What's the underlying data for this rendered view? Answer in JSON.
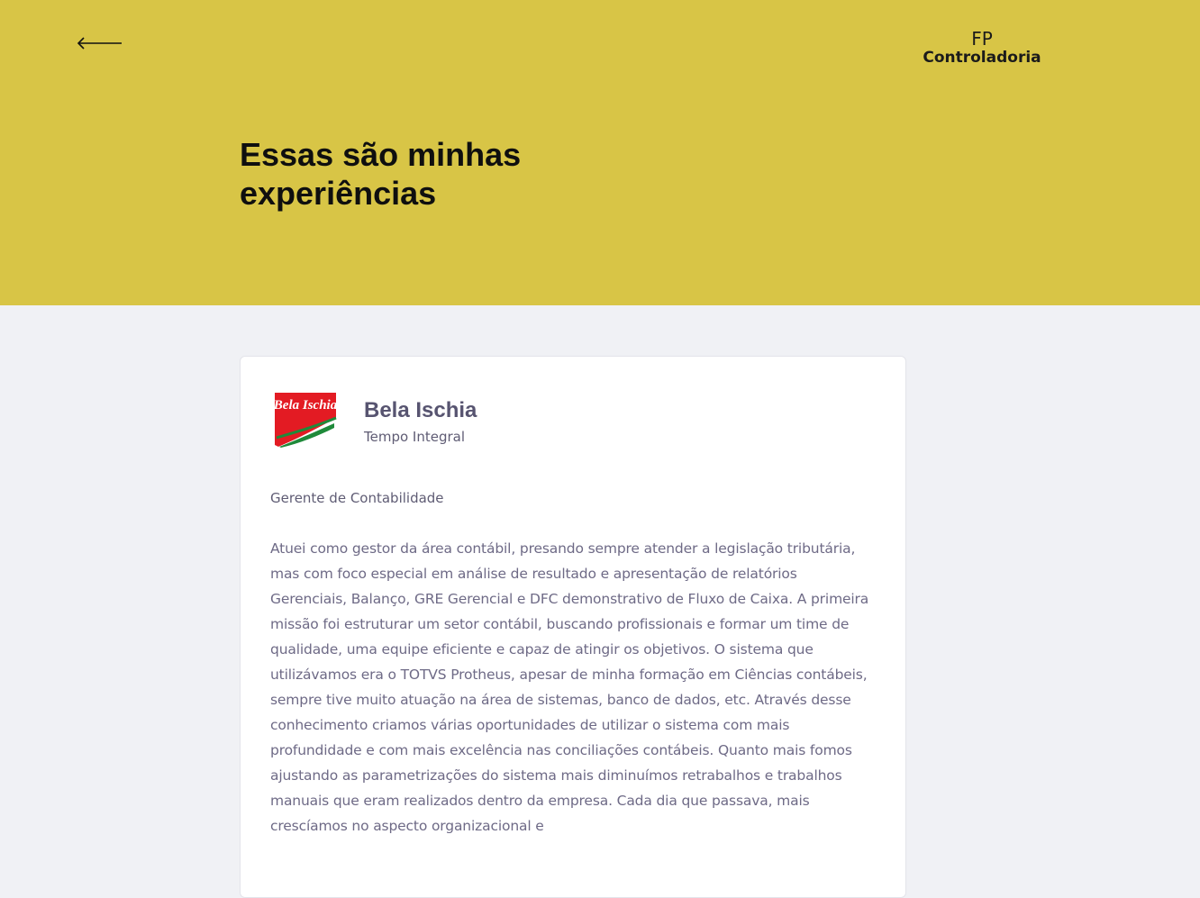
{
  "header": {
    "back_icon": "arrow-left-icon",
    "logo": {
      "line1": "FP",
      "line2": "Controladoria"
    },
    "title": "Essas são minhas experiências",
    "background_color": "#d8c546"
  },
  "experiences": [
    {
      "company": "Bela Ischia",
      "company_logo_text": "Bela Ischia",
      "employment_type": "Tempo Integral",
      "role": "Gerente de Contabilidade",
      "description": "Atuei como gestor da área contábil, presando sempre atender a legislação tributária, mas com foco especial em análise de resultado e apresentação de relatórios Gerenciais, Balanço, GRE Gerencial e DFC demonstrativo de Fluxo de Caixa. A primeira missão foi estruturar um setor contábil, buscando profissionais e formar um time de qualidade, uma equipe eficiente e capaz de atingir os objetivos. O sistema que utilizávamos era o TOTVS Protheus, apesar de minha formação em Ciências contábeis, sempre tive muito atuação na área de sistemas, banco de dados, etc. Através desse conhecimento criamos várias oportunidades de utilizar o sistema com mais profundidade e com mais excelência nas conciliações contábeis. Quanto mais fomos ajustando as parametrizações do sistema mais diminuímos retrabalhos e trabalhos manuais que eram realizados dentro da empresa. Cada dia que passava, mais crescíamos no aspecto organizacional e"
    }
  ]
}
